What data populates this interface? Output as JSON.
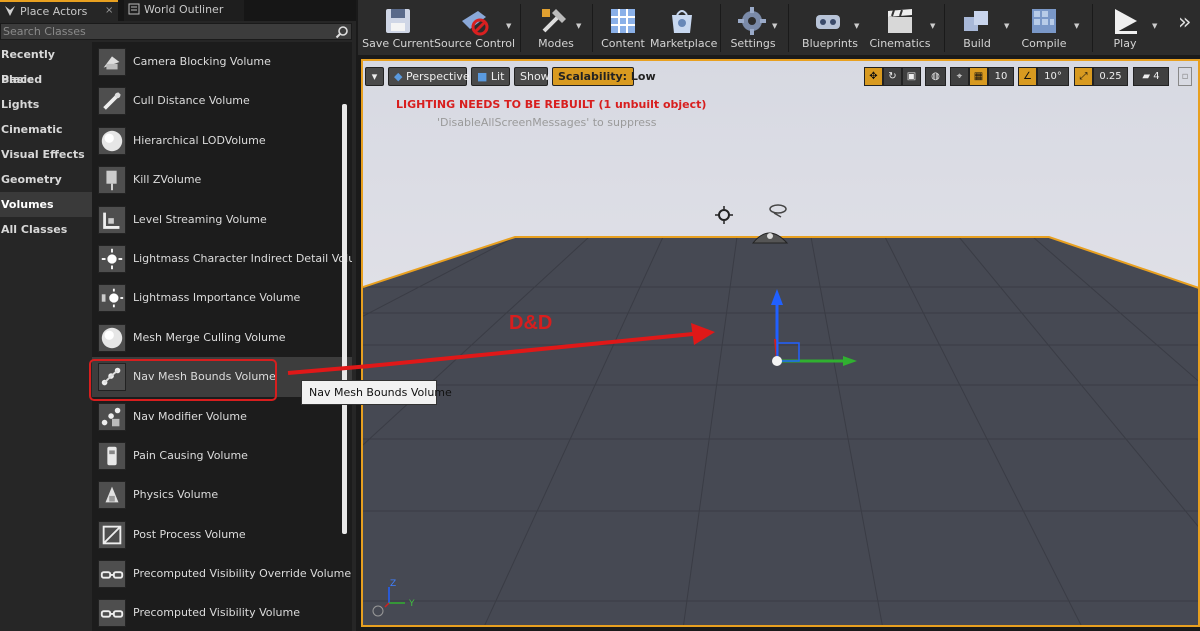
{
  "tabs": {
    "place_actors": "Place Actors",
    "world_outliner": "World Outliner",
    "close_glyph": "×"
  },
  "search": {
    "placeholder": "Search Classes"
  },
  "categories": [
    "Recently Placed",
    "Basic",
    "Lights",
    "Cinematic",
    "Visual Effects",
    "Geometry",
    "Volumes",
    "All Classes"
  ],
  "active_category": "Volumes",
  "items": [
    {
      "label": "Camera Blocking Volume",
      "icon": "blocking-volume-icon"
    },
    {
      "label": "Cull Distance Volume",
      "icon": "cull-volume-icon"
    },
    {
      "label": "Hierarchical LODVolume",
      "icon": "sphere-icon"
    },
    {
      "label": "Kill ZVolume",
      "icon": "kill-z-icon"
    },
    {
      "label": "Level Streaming Volume",
      "icon": "level-streaming-icon"
    },
    {
      "label": "Lightmass Character Indirect Detail Volum",
      "icon": "lightmass-sun-icon"
    },
    {
      "label": "Lightmass Importance Volume",
      "icon": "lightmass-importance-icon"
    },
    {
      "label": "Mesh Merge Culling Volume",
      "icon": "sphere-icon"
    },
    {
      "label": "Nav Mesh Bounds Volume",
      "icon": "nav-mesh-icon"
    },
    {
      "label": "Nav Modifier Volume",
      "icon": "nav-modifier-icon"
    },
    {
      "label": "Pain Causing Volume",
      "icon": "pain-volume-icon"
    },
    {
      "label": "Physics Volume",
      "icon": "physics-volume-icon"
    },
    {
      "label": "Post Process Volume",
      "icon": "post-process-icon"
    },
    {
      "label": "Precomputed Visibility Override Volume",
      "icon": "visibility-override-icon"
    },
    {
      "label": "Precomputed Visibility Volume",
      "icon": "visibility-volume-icon"
    }
  ],
  "highlighted_item": "Nav Mesh Bounds Volume",
  "tooltip": "Nav Mesh Bounds Volume",
  "toolbar": [
    {
      "label": "Save Current",
      "icon": "save-icon"
    },
    {
      "label": "Source Control",
      "icon": "source-control-icon"
    },
    {
      "label": "Modes",
      "icon": "modes-icon"
    },
    {
      "label": "Content",
      "icon": "content-icon"
    },
    {
      "label": "Marketplace",
      "icon": "marketplace-icon"
    },
    {
      "label": "Settings",
      "icon": "settings-icon"
    },
    {
      "label": "Blueprints",
      "icon": "blueprints-icon"
    },
    {
      "label": "Cinematics",
      "icon": "cinematics-icon"
    },
    {
      "label": "Build",
      "icon": "build-icon"
    },
    {
      "label": "Compile",
      "icon": "compile-icon"
    },
    {
      "label": "Play",
      "icon": "play-icon"
    }
  ],
  "toolbar_overflow": "»",
  "viewport": {
    "dropdown": "▾",
    "perspective": "Perspective",
    "lit": "Lit",
    "show": "Show",
    "scalability": "Scalability: Low",
    "grid_snap": "10",
    "rotate_snap": "10°",
    "scale_snap": "0.25",
    "camera_speed": "4",
    "warning": "LIGHTING NEEDS TO BE REBUILT (1 unbuilt object)",
    "warning_hint": "'DisableAllScreenMessages' to suppress",
    "annotation": "D&D",
    "axis_z": "Z",
    "axis_y": "Y"
  },
  "colors": {
    "accent": "#e8a020",
    "highlight_red": "#d81e1e",
    "gizmo_z": "#2060ff",
    "gizmo_y": "#30b030",
    "gizmo_x": "#d02020"
  }
}
